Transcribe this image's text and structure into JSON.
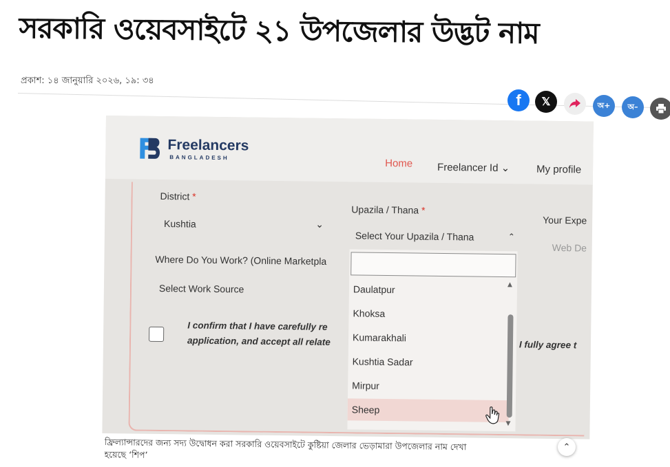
{
  "article": {
    "headline": "সরকারি ওয়েবসাইটে ২১ উপজেলার উদ্ভট নাম",
    "dateline": "প্রকাশ: ১৪ জানুয়ারি ২০২৬, ১৯: ৩৪",
    "caption_line1": "ফ্রিল্যান্সারদের জন্য সদ্য উদ্বোধন করা সরকারি ওয়েবসাইটে কুষ্টিয়া জেলার ভেড়ামারা উপজেলার নাম দেখা",
    "caption_line2": "হয়েছে ‘শিপ’"
  },
  "share": {
    "font_plus": "অ+",
    "font_minus": "অ–",
    "icons": [
      "facebook-icon",
      "x-icon",
      "share-arrow-icon",
      "font-increase-icon",
      "font-decrease-icon",
      "print-icon"
    ],
    "colors": {
      "facebook": "#1877f2",
      "x": "#111111",
      "share_bg": "#eeeeee",
      "share_arrow": "#e0245e",
      "font_btn": "#3b82d6",
      "print": "#555555"
    }
  },
  "screenshot": {
    "logo_title": "Freelancers",
    "logo_subtitle": "BANGLADESH",
    "nav": {
      "home": "Home",
      "freelancer_id": "Freelancer Id",
      "my_profile": "My profile"
    },
    "form": {
      "district_label": "District",
      "district_value": "Kushtia",
      "upazila_label": "Upazila / Thana",
      "upazila_placeholder": "Select Your Upazila / Thana",
      "experience_label": "Your Expe",
      "experience_value": "Web De",
      "work_label": "Where Do You Work? (Online Marketpla",
      "work_value": "Select Work Source",
      "confirm_line1": "I confirm that I have carefully re",
      "confirm_line2": "application, and accept all relate",
      "confirm_right": "I fully agree t",
      "required_mark": "*"
    },
    "upazila_options": [
      "Daulatpur",
      "Khoksa",
      "Kumarakhali",
      "Kushtia Sadar",
      "Mirpur",
      "Sheep"
    ],
    "selected_option": "Sheep",
    "colors": {
      "home_nav": "#e0574f",
      "required": "#d93025",
      "highlight": "#f1d7d3",
      "brand": "#243a63"
    }
  }
}
